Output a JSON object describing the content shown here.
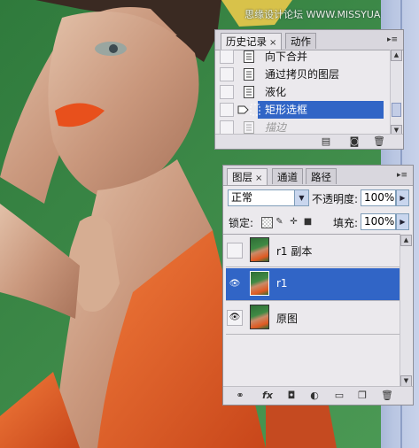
{
  "watermark": "思缘设计论坛 WWW.MISSYUAN.COM",
  "history_panel": {
    "tabs": [
      {
        "label": "历史记录",
        "close": "×",
        "active": true
      },
      {
        "label": "动作",
        "active": false
      }
    ],
    "menu": "▸≡",
    "items": [
      {
        "label": "向下合并",
        "state": "normal"
      },
      {
        "label": "通过拷贝的图层",
        "state": "normal"
      },
      {
        "label": "液化",
        "state": "normal"
      },
      {
        "label": "矩形选框",
        "state": "selected"
      },
      {
        "label": "描边",
        "state": "dimmed"
      }
    ],
    "footer_icons": [
      "new-document-from-state-icon",
      "camera-snapshot-icon",
      "trash-icon"
    ]
  },
  "layers_panel": {
    "tabs": [
      {
        "label": "图层",
        "close": "×",
        "active": true
      },
      {
        "label": "通道",
        "active": false
      },
      {
        "label": "路径",
        "active": false
      }
    ],
    "menu": "▸≡",
    "blend_mode": "正常",
    "opacity_label": "不透明度:",
    "opacity_value": "100%",
    "lock_label": "锁定:",
    "fill_label": "填充:",
    "fill_value": "100%",
    "layers": [
      {
        "name": "r1 副本",
        "visible": false,
        "selected": false
      },
      {
        "name": "r1",
        "visible": true,
        "selected": true
      },
      {
        "name": "原图",
        "visible": true,
        "selected": false
      }
    ],
    "footer_icons": [
      "link-icon",
      "fx-icon",
      "mask-icon",
      "adjustment-layer-icon",
      "group-folder-icon",
      "new-layer-icon",
      "trash-icon"
    ],
    "footer_fx": "fx"
  },
  "colors": {
    "selection": "#3165c6",
    "background_green": "#3c8a48",
    "lip_orange": "#e8501c"
  }
}
